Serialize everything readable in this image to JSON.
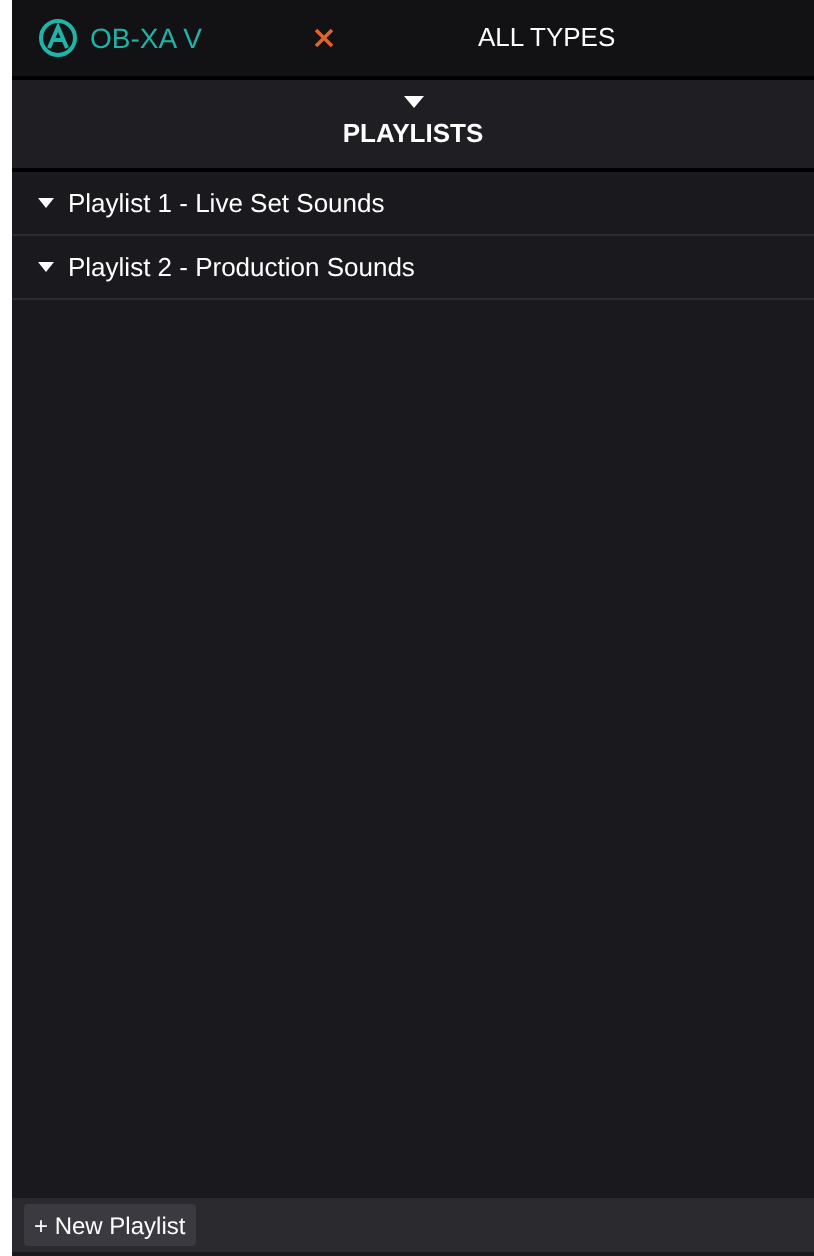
{
  "top_bar": {
    "logo_text": "OB-XA V",
    "filter": "ALL TYPES"
  },
  "section": {
    "title": "PLAYLISTS",
    "expanded": true
  },
  "playlists": [
    {
      "label": "Playlist 1 - Live Set Sounds",
      "expanded": true
    },
    {
      "label": "Playlist 2 - Production Sounds",
      "expanded": true
    }
  ],
  "footer": {
    "button": "+ New Playlist"
  }
}
